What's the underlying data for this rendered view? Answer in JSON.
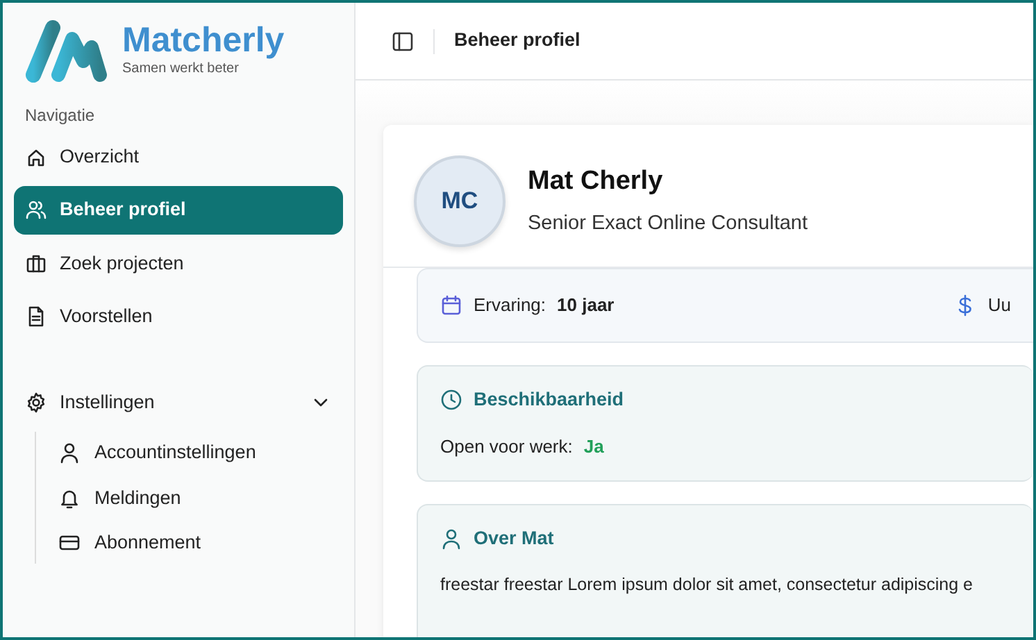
{
  "brand": {
    "name": "Matcherly",
    "tagline": "Samen werkt beter"
  },
  "sidebar": {
    "section_label": "Navigatie",
    "items": [
      {
        "label": "Overzicht",
        "selected": false
      },
      {
        "label": "Beheer profiel",
        "selected": true
      },
      {
        "label": "Zoek projecten",
        "selected": false
      },
      {
        "label": "Voorstellen",
        "selected": false
      }
    ],
    "settings": {
      "label": "Instellingen",
      "expanded": true,
      "children": [
        {
          "label": "Accountinstellingen",
          "selected": false
        },
        {
          "label": "Meldingen",
          "selected": false
        },
        {
          "label": "Abonnement",
          "selected": false
        }
      ]
    }
  },
  "header": {
    "title": "Beheer profiel"
  },
  "profile": {
    "initials": "MC",
    "name": "Mat Cherly",
    "title": "Senior Exact Online Consultant",
    "stats": [
      {
        "label": "Ervaring:",
        "value": "10 jaar"
      },
      {
        "label": "Uu"
      }
    ],
    "availability": {
      "heading": "Beschikbaarheid",
      "label": "Open voor werk:",
      "value": "Ja",
      "open": true
    },
    "about": {
      "heading": "Over Mat",
      "text": "freestar freestar Lorem ipsum dolor sit amet, consectetur adipiscing e"
    }
  }
}
